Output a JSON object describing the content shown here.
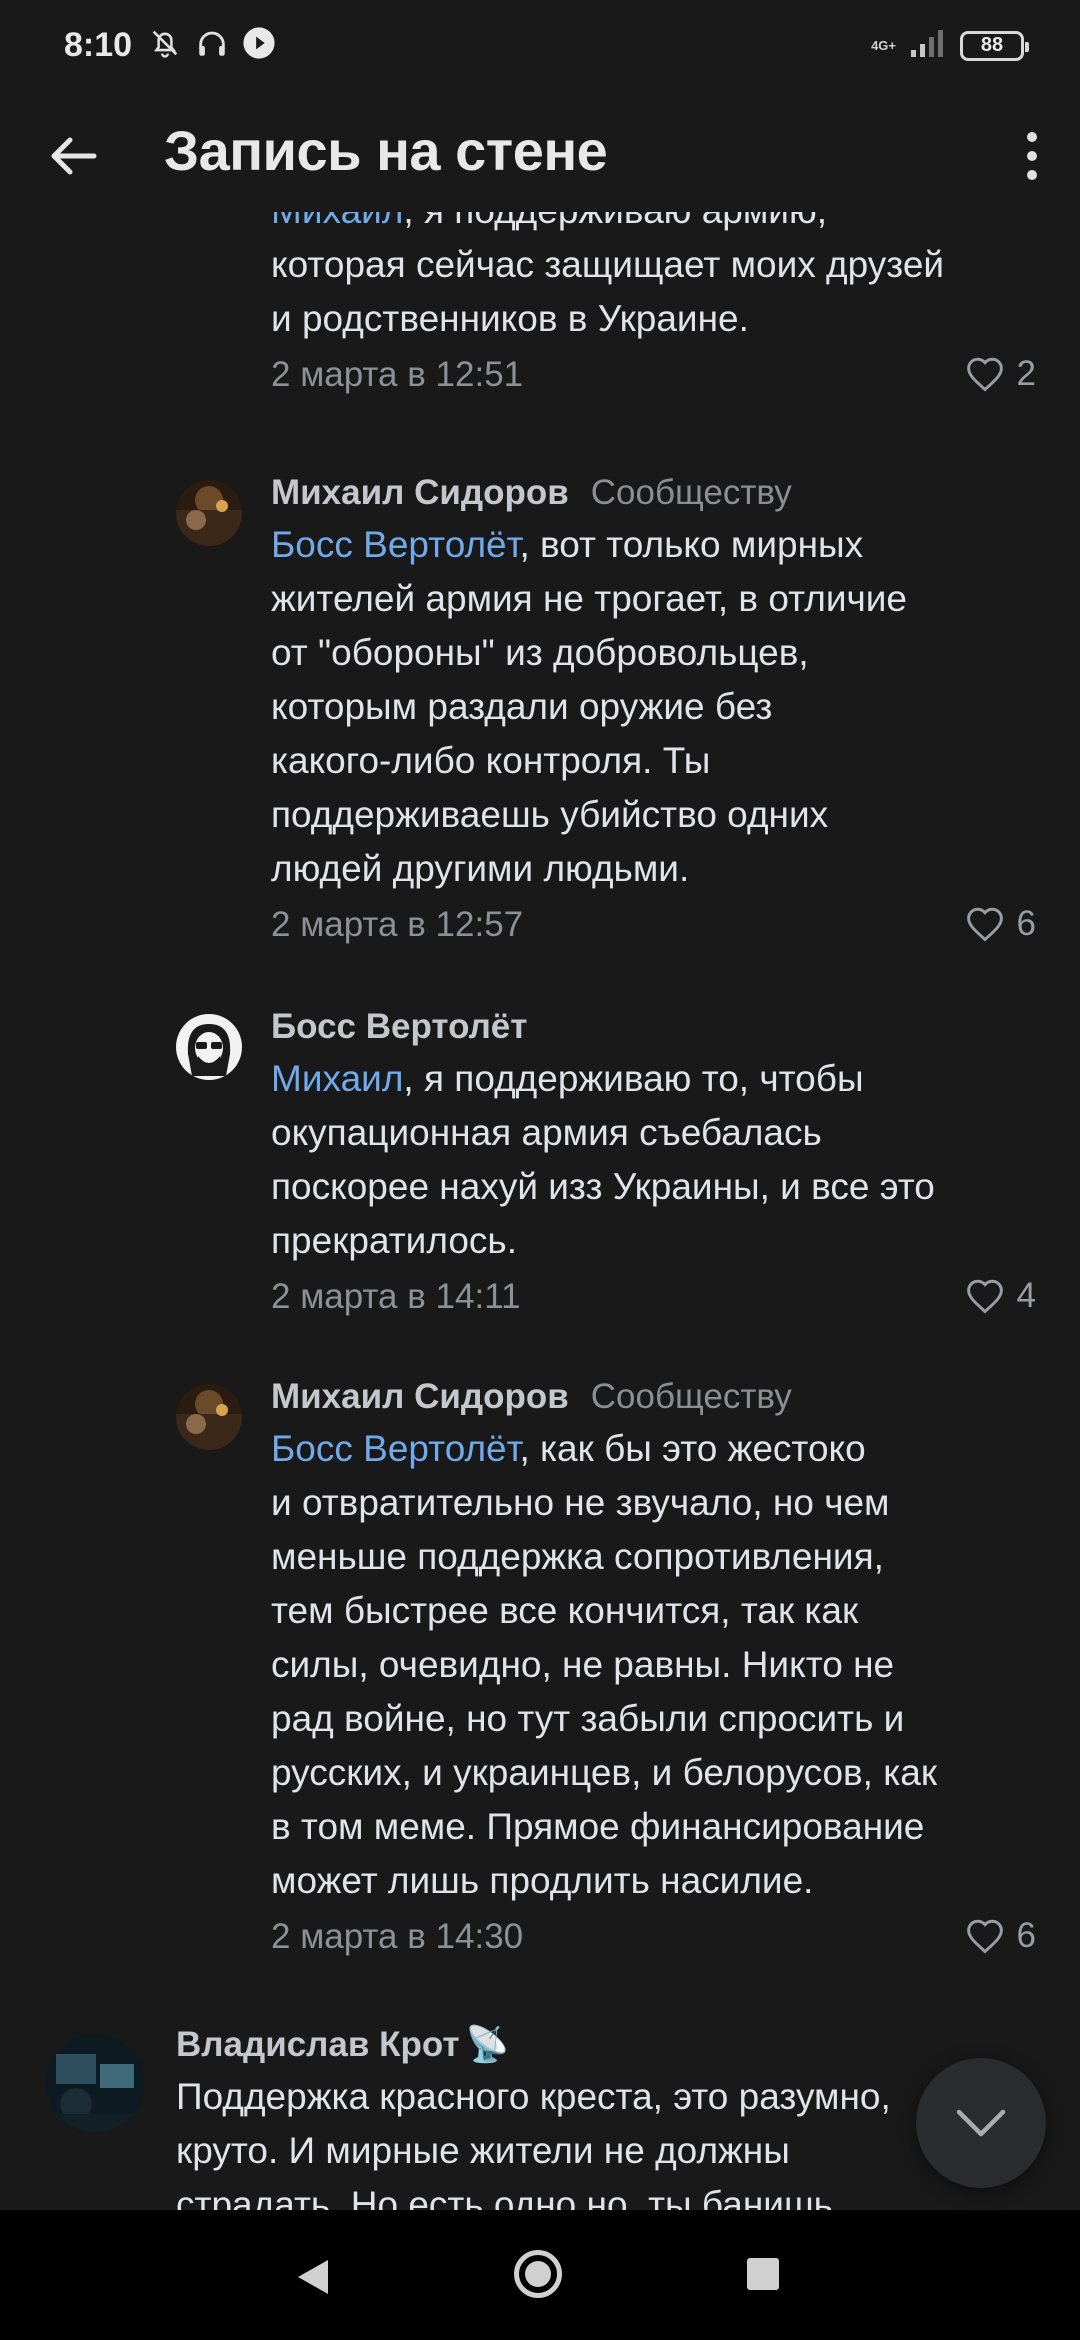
{
  "status_bar": {
    "time": "8:10",
    "network": "4G+",
    "battery": "88"
  },
  "header": {
    "title": "Запись на стене"
  },
  "comments": [
    {
      "author": "",
      "badge": "",
      "mention": "Михаил",
      "lines": [
        ", я поддерживаю армию,",
        "которая сейчас защищает моих друзей",
        "и родственников в Украине."
      ],
      "date": "2 марта в 12:51",
      "likes": "2"
    },
    {
      "author": "Михаил Сидоров",
      "badge": "Сообществу",
      "mention": "Босс Вертолёт",
      "lines": [
        ", вот только мирных",
        "жителей армия не трогает, в отличие",
        "от \"обороны\" из добровольцев,",
        "которым раздали оружие без",
        "какого-либо контроля. Ты",
        "поддерживаешь убийство одних",
        "людей другими людьми."
      ],
      "date": "2 марта в 12:57",
      "likes": "6"
    },
    {
      "author": "Босс Вертолёт",
      "badge": "",
      "mention": "Михаил",
      "lines": [
        ", я поддерживаю то, чтобы",
        "окупационная армия съебалась",
        "поскорее нахуй изз Украины, и все это",
        "прекратилось."
      ],
      "date": "2 марта в 14:11",
      "likes": "4"
    },
    {
      "author": "Михаил Сидоров",
      "badge": "Сообществу",
      "mention": "Босс Вертолёт",
      "lines": [
        ", как бы это жестоко",
        "и отвратительно не звучало, но чем",
        "меньше поддержка сопротивления,",
        "тем быстрее все кончится, так как",
        "силы, очевидно, не равны. Никто не",
        "рад войне, но тут забыли спросить и",
        "русских, и украинцев, и белорусов, как",
        "в том меме. Прямое финансирование",
        "может лишь продлить насилие."
      ],
      "date": "2 марта в 14:30",
      "likes": "6"
    },
    {
      "author": "Владислав Крот",
      "author_emoji": "📡",
      "lines": [
        "Поддержка красного креста, это разумно,",
        "круто. И мирные жители не должны",
        "страдать. Но есть одно но, ты банишь"
      ]
    }
  ],
  "icons": {
    "back": "arrow-left-icon",
    "more": "more-vertical-icon",
    "like": "heart-outline-icon",
    "scroll": "chevron-down-icon"
  },
  "colors": {
    "background": "#19191a",
    "mention": "#71aaeb",
    "text": "#e1e3e6",
    "muted": "#8d9095"
  }
}
